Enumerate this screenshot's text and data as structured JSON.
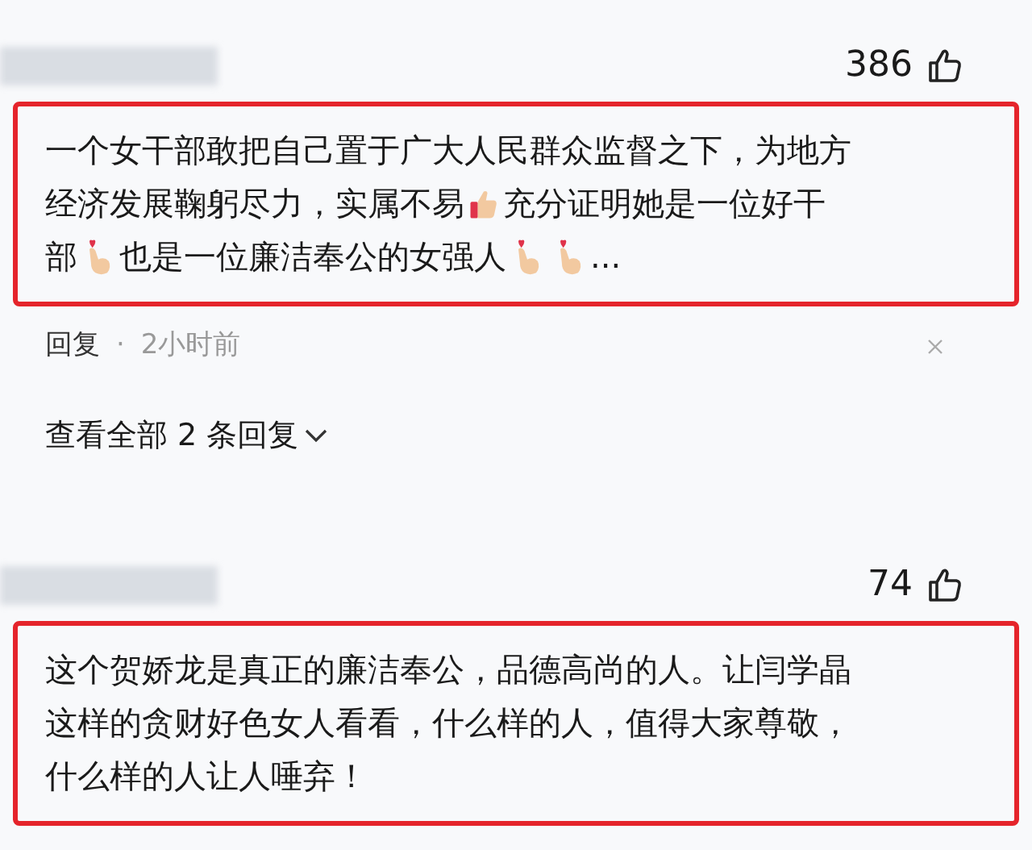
{
  "comments": [
    {
      "likes": "386",
      "lines": [
        [
          {
            "kind": "text",
            "text": "一个女干部敢把自己置于广大人民群众监督之下，为地方"
          }
        ],
        [
          {
            "kind": "text",
            "text": "经济发展鞠躬尽力，实属不易"
          },
          {
            "kind": "thumbs-up"
          },
          {
            "kind": "text",
            "text": "充分证明她是一位好干"
          }
        ],
        [
          {
            "kind": "text",
            "text": "部"
          },
          {
            "kind": "finger-heart"
          },
          {
            "kind": "text",
            "text": "也是一位廉洁奉公的女强人"
          },
          {
            "kind": "finger-heart"
          },
          {
            "kind": "finger-heart"
          },
          {
            "kind": "text",
            "text": "..."
          }
        ]
      ],
      "reply": "回复",
      "separator": "·",
      "time": "2小时前",
      "view_replies": "查看全部 2 条回复"
    },
    {
      "likes": "74",
      "lines": [
        [
          {
            "kind": "text",
            "text": "这个贺娇龙是真正的廉洁奉公，品德高尚的人。让闫学晶"
          }
        ],
        [
          {
            "kind": "text",
            "text": "这样的贪财好色女人看看，什么样的人，值得大家尊敬，"
          }
        ],
        [
          {
            "kind": "text",
            "text": "什么样的人让人唾弃！"
          }
        ]
      ]
    }
  ]
}
